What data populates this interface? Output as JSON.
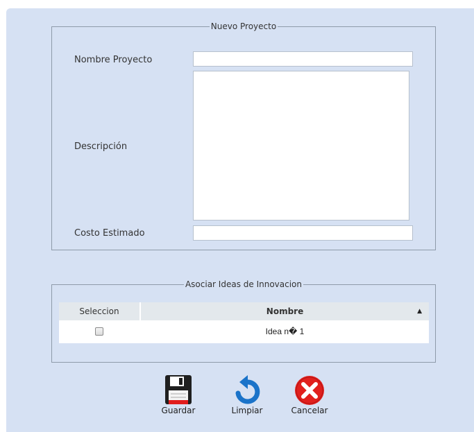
{
  "form": {
    "legend": "Nuevo Proyecto",
    "nombre_label": "Nombre Proyecto",
    "nombre_value": "",
    "descripcion_label": "Descripción",
    "descripcion_value": "",
    "costo_label": "Costo Estimado",
    "costo_value": ""
  },
  "ideas": {
    "legend": "Asociar Ideas de Innovacion",
    "columns": [
      "Seleccion",
      "Nombre"
    ],
    "rows": [
      {
        "selected": false,
        "nombre": "Idea n� 1"
      }
    ]
  },
  "actions": {
    "save_label": "Guardar",
    "clear_label": "Limpiar",
    "cancel_label": "Cancelar"
  },
  "colors": {
    "panel_bg": "#d6e1f3",
    "border": "#8e9aa9",
    "cancel_red": "#e1201d",
    "refresh_blue": "#1a73c9"
  }
}
